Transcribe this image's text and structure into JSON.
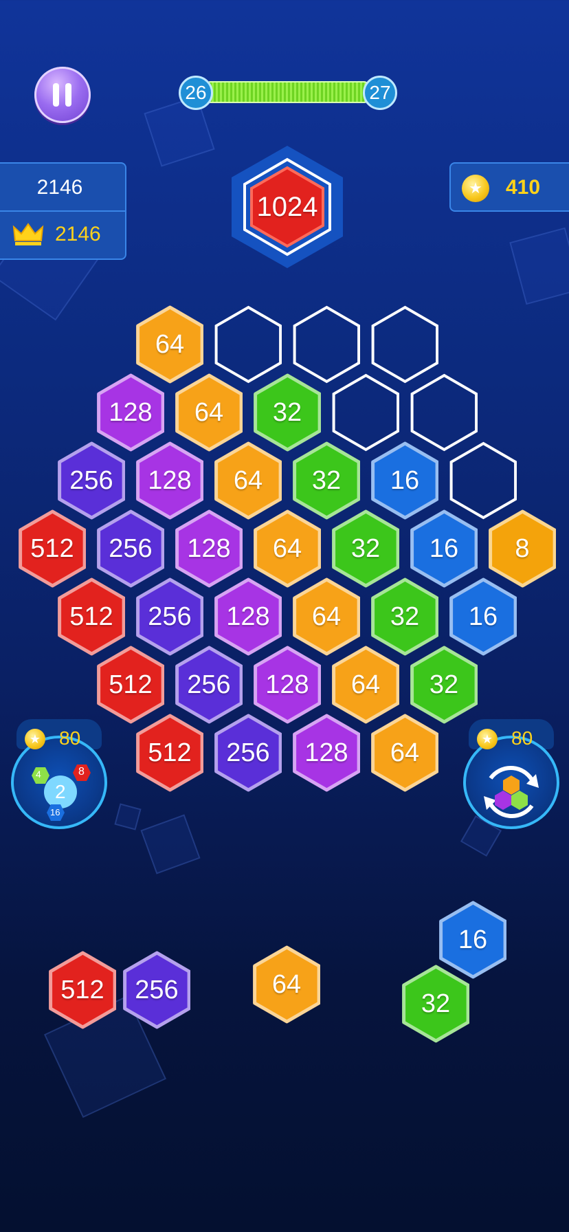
{
  "level": {
    "current": "26",
    "next": "27",
    "progress": 1.0
  },
  "score": {
    "current": "2146",
    "best": "2146"
  },
  "coins": "410",
  "target": "1024",
  "boosters": [
    {
      "cost": "80",
      "name": "merge-booster",
      "mini_tiles": [
        "4",
        "8",
        "2",
        "16"
      ]
    },
    {
      "cost": "80",
      "name": "shuffle-booster"
    }
  ],
  "board": [
    [
      "64",
      "",
      "",
      ""
    ],
    [
      "128",
      "64",
      "32",
      "",
      ""
    ],
    [
      "256",
      "128",
      "64",
      "32",
      "16",
      ""
    ],
    [
      "512",
      "256",
      "128",
      "64",
      "32",
      "16",
      "8"
    ],
    [
      "512",
      "256",
      "128",
      "64",
      "32",
      "16"
    ],
    [
      "512",
      "256",
      "128",
      "64",
      "32"
    ],
    [
      "512",
      "256",
      "128",
      "64"
    ]
  ],
  "next_pieces": [
    [
      "512",
      "256"
    ],
    [
      "64"
    ],
    [
      "16",
      "32"
    ]
  ],
  "colors": {
    "8": "#f4a30b",
    "16": "#1a6fe0",
    "32": "#3cc61b",
    "64": "#f7a218",
    "128": "#a734e4",
    "256": "#5a2fd8",
    "512": "#e2221e",
    "1024": "#e2221e"
  }
}
